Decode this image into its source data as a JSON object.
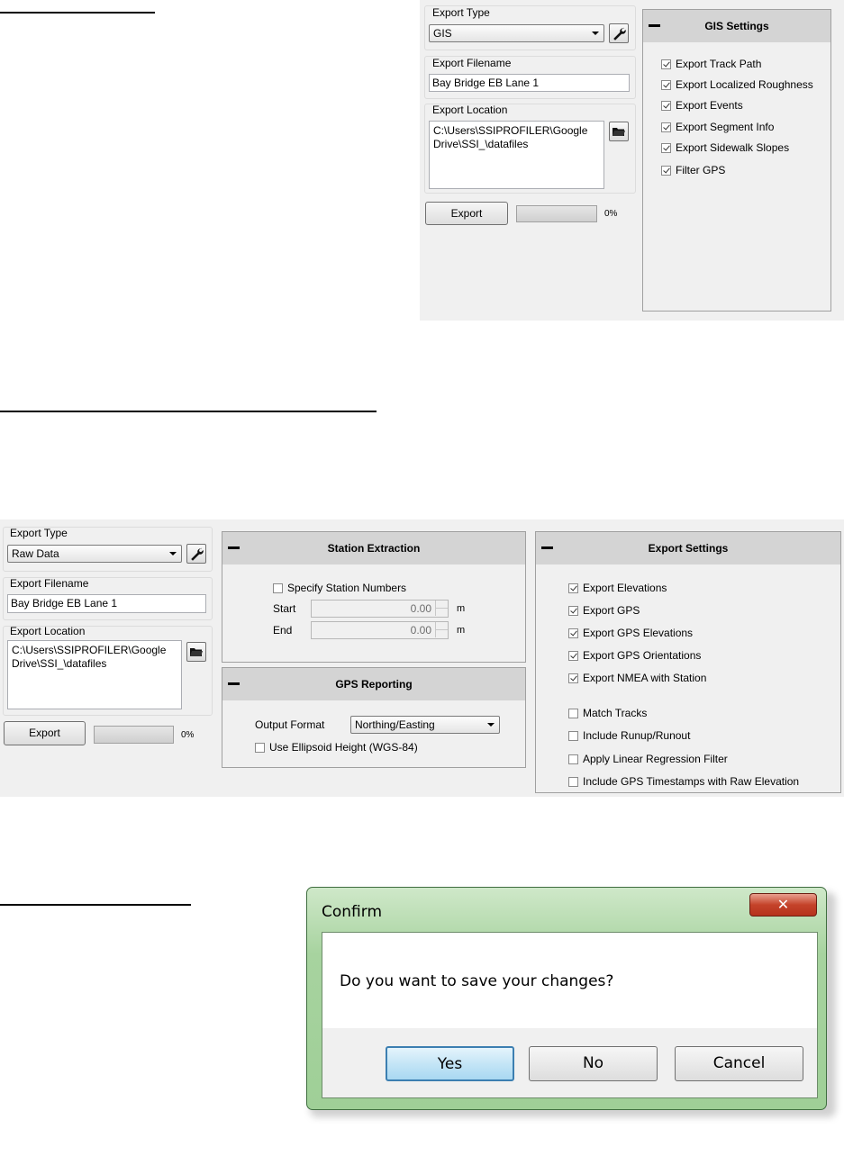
{
  "gis_panel": {
    "export_type_label": "Export Type",
    "export_type_value": "GIS",
    "export_filename_label": "Export Filename",
    "export_filename_value": "Bay Bridge EB Lane 1",
    "export_location_label": "Export Location",
    "export_location_value": "C:\\Users\\SSIPROFILER\\Google Drive\\SSI_\\datafiles",
    "export_button": "Export",
    "progress_text": "0%",
    "progress_value": 0,
    "settings": {
      "title": "GIS Settings",
      "options": [
        {
          "label": "Export Track Path",
          "checked": true
        },
        {
          "label": "Export Localized Roughness",
          "checked": true
        },
        {
          "label": "Export Events",
          "checked": true
        },
        {
          "label": "Export Segment Info",
          "checked": true
        },
        {
          "label": "Export Sidewalk Slopes",
          "checked": true
        },
        {
          "label": "Filter GPS",
          "checked": true
        }
      ]
    }
  },
  "raw_panel": {
    "export_type_label": "Export Type",
    "export_type_value": "Raw Data",
    "export_filename_label": "Export Filename",
    "export_filename_value": "Bay Bridge EB Lane 1",
    "export_location_label": "Export Location",
    "export_location_value": "C:\\Users\\SSIPROFILER\\Google Drive\\SSI_\\datafiles",
    "export_button": "Export",
    "progress_text": "0%",
    "progress_value": 0,
    "station_extraction": {
      "title": "Station Extraction",
      "specify_label": "Specify Station Numbers",
      "specify_checked": false,
      "start_label": "Start",
      "start_value": "0.00",
      "end_label": "End",
      "end_value": "0.00",
      "unit": "m"
    },
    "gps_reporting": {
      "title": "GPS Reporting",
      "output_format_label": "Output Format",
      "output_format_value": "Northing/Easting",
      "ellipsoid_label": "Use Ellipsoid Height (WGS-84)",
      "ellipsoid_checked": false
    },
    "export_settings": {
      "title": "Export Settings",
      "options_group1": [
        {
          "label": "Export Elevations",
          "checked": true
        },
        {
          "label": "Export GPS",
          "checked": true
        },
        {
          "label": "Export GPS Elevations",
          "checked": true
        },
        {
          "label": "Export GPS Orientations",
          "checked": true
        },
        {
          "label": "Export NMEA with Station",
          "checked": true
        }
      ],
      "options_group2": [
        {
          "label": "Match Tracks",
          "checked": false
        },
        {
          "label": "Include Runup/Runout",
          "checked": false
        },
        {
          "label": "Apply Linear Regression Filter",
          "checked": false
        },
        {
          "label": "Include GPS Timestamps with Raw Elevation",
          "checked": false
        }
      ]
    }
  },
  "confirm_dialog": {
    "title": "Confirm",
    "close_glyph": "✕",
    "message": "Do you want to save your changes?",
    "buttons": {
      "yes": "Yes",
      "no": "No",
      "cancel": "Cancel"
    }
  }
}
